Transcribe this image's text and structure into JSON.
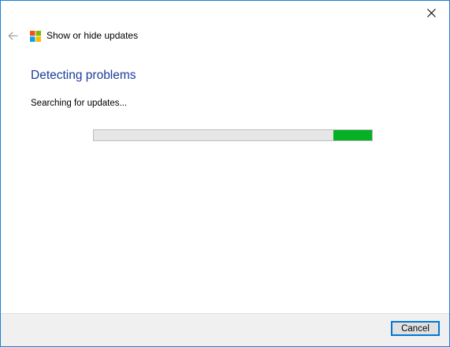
{
  "window": {
    "title": "Show or hide updates",
    "icons": {
      "close": "close-icon",
      "back": "back-arrow-icon",
      "app": "windows-logo-icon"
    }
  },
  "main": {
    "heading": "Detecting problems",
    "status": "Searching for updates...",
    "progress": {
      "style": "marquee",
      "fill_start": 0.86,
      "fill_end": 1.0,
      "fill_color": "#06b025"
    }
  },
  "footer": {
    "cancel_label": "Cancel"
  },
  "colors": {
    "heading": "#1a3d9c",
    "window_border": "#1883d7",
    "button_focus": "#0078d7",
    "logo": [
      "#f25022",
      "#7fba00",
      "#00a4ef",
      "#ffb900"
    ]
  }
}
